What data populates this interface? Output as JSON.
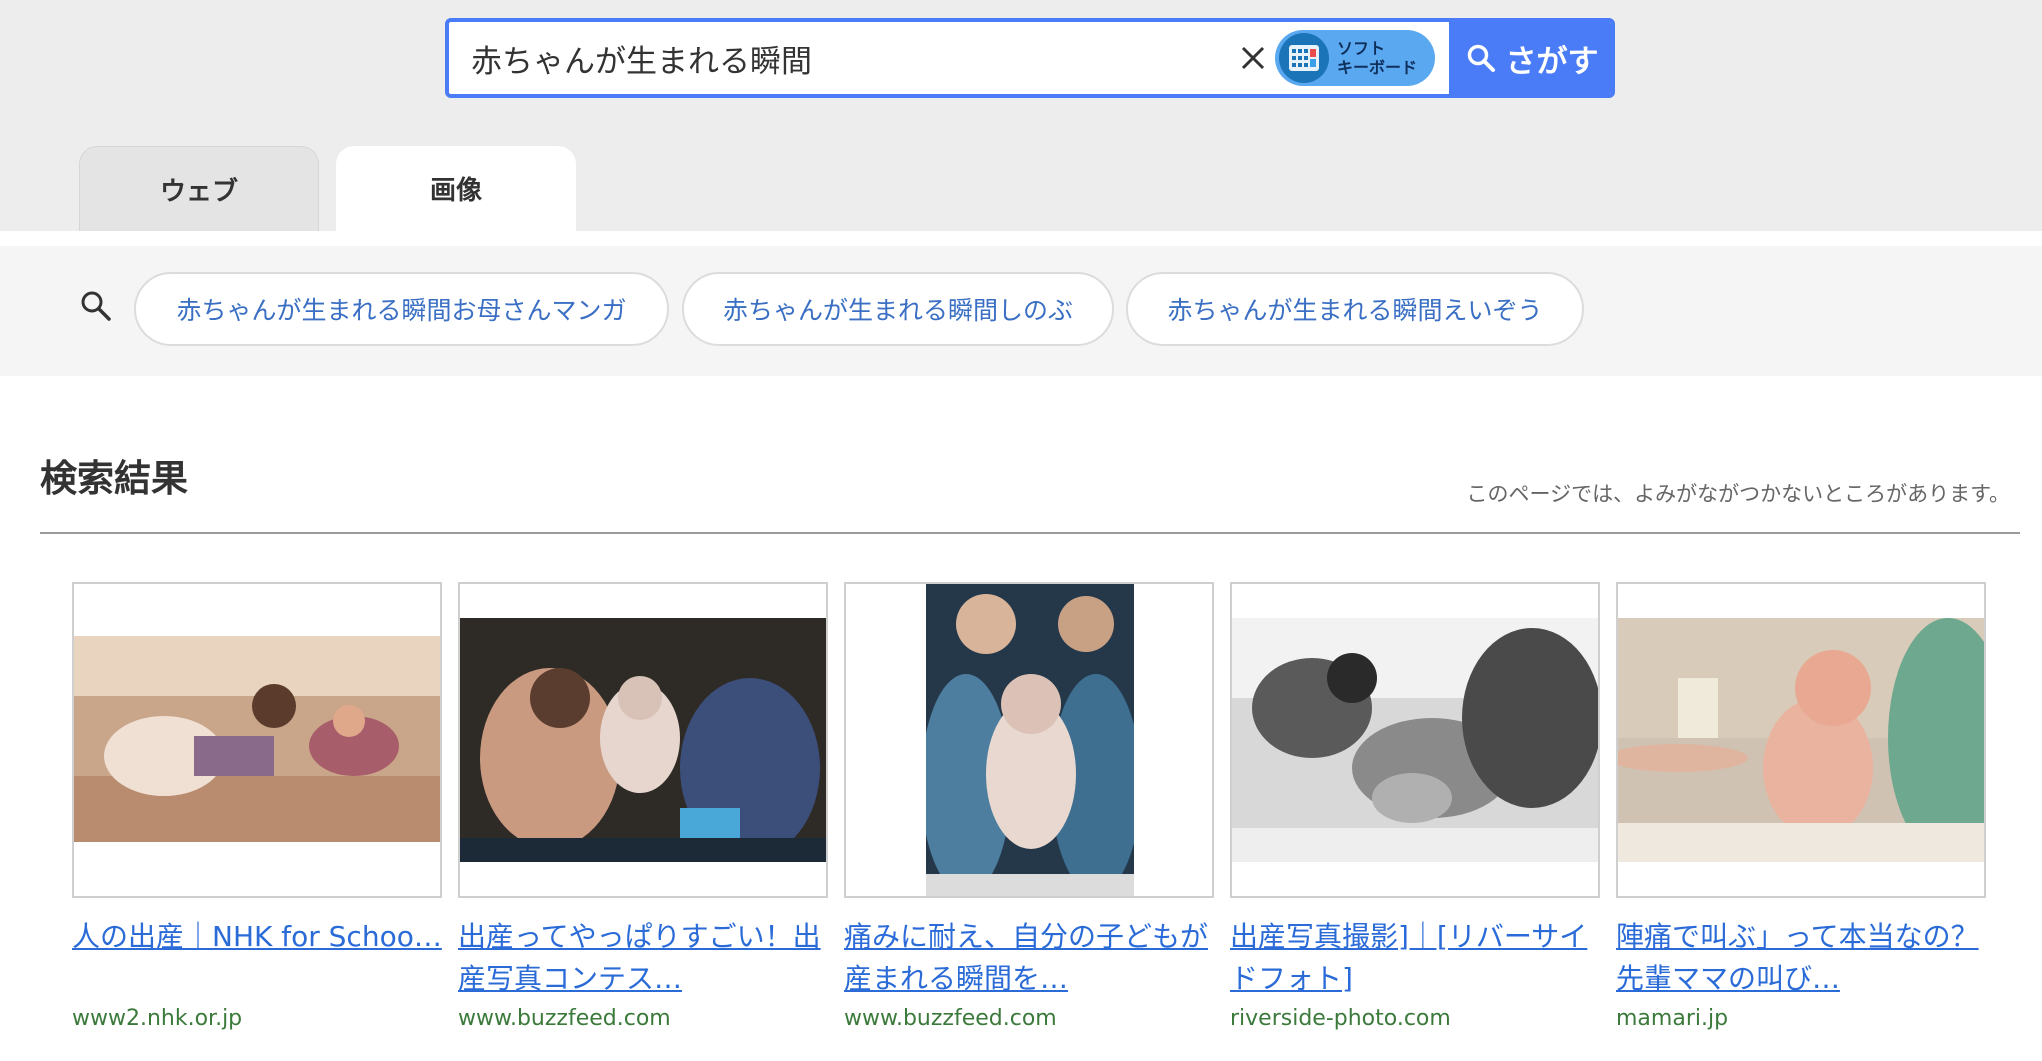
{
  "search": {
    "query": "赤ちゃんが生まれる瞬間",
    "soft_keyboard_line1": "ソフト",
    "soft_keyboard_line2": "キーボード",
    "submit_label": "さがす"
  },
  "tabs": [
    {
      "label": "ウェブ",
      "active": false
    },
    {
      "label": "画像",
      "active": true
    }
  ],
  "suggestions": [
    "赤ちゃんが生まれる瞬間お母さんマンガ",
    "赤ちゃんが生まれる瞬間しのぶ",
    "赤ちゃんが生まれる瞬間えいぞう"
  ],
  "results": {
    "title": "検索結果",
    "note": "このページでは、よみがながつかないところがあります。",
    "items": [
      {
        "title": "人の出産｜NHK for Schoo…",
        "domain": "www2.nhk.or.jp"
      },
      {
        "title": "出産ってやっぱりすごい！出産写真コンテス…",
        "domain": "www.buzzfeed.com"
      },
      {
        "title": "痛みに耐え、自分の子どもが産まれる瞬間を…",
        "domain": "www.buzzfeed.com"
      },
      {
        "title": "出産写真撮影]｜[リバーサイドフォト]",
        "domain": "riverside-photo.com"
      },
      {
        "title": "陣痛で叫ぶ」って本当なの？先輩ママの叫び…",
        "domain": "mamari.jp"
      }
    ]
  },
  "colors": {
    "accent": "#4a7cf7",
    "link": "#2a6bd8",
    "domain": "#3c7a3c"
  }
}
